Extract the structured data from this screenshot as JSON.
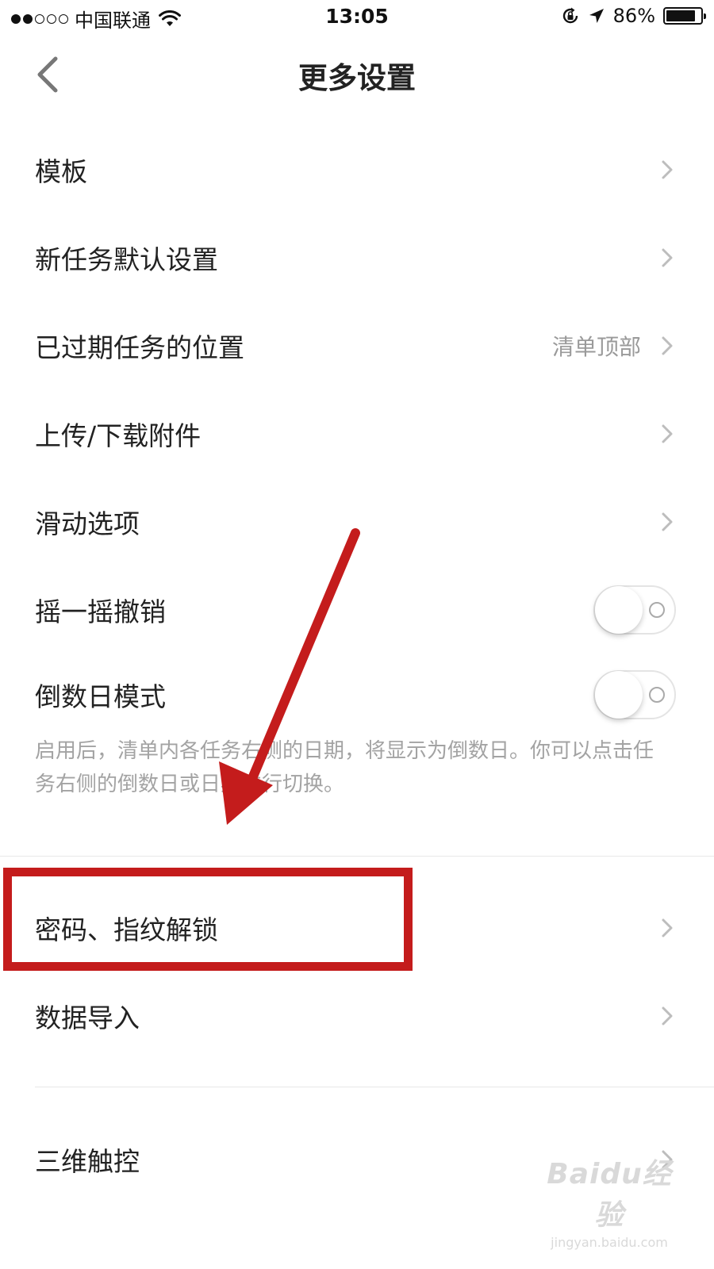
{
  "status_bar": {
    "carrier": "中国联通",
    "time": "13:05",
    "battery_percent": "86%",
    "battery_level": 0.86,
    "signal_dots_filled": 2,
    "signal_dots_total": 5
  },
  "nav": {
    "title": "更多设置",
    "back_icon": "chevron-left-icon"
  },
  "settings": {
    "template": {
      "label": "模板"
    },
    "new_task_defaults": {
      "label": "新任务默认设置"
    },
    "overdue_position": {
      "label": "已过期任务的位置",
      "value": "清单顶部"
    },
    "attachments": {
      "label": "上传/下载附件"
    },
    "swipe_options": {
      "label": "滑动选项"
    },
    "shake_undo": {
      "label": "摇一摇撤销",
      "enabled": false
    },
    "countdown_mode": {
      "label": "倒数日模式",
      "enabled": false
    },
    "countdown_description": "启用后，清单内各任务右侧的日期，将显示为倒数日。你可以点击任务右侧的倒数日或日期进行切换。",
    "password_unlock": {
      "label": "密码、指纹解锁"
    },
    "data_import": {
      "label": "数据导入"
    },
    "three_d_touch": {
      "label": "三维触控"
    }
  },
  "watermark": {
    "logo": "Baidu经验",
    "url": "jingyan.baidu.com"
  },
  "colors": {
    "annotation_red": "#c41c1c",
    "text_primary": "#222222",
    "text_secondary": "#9a9a9a",
    "chevron": "#bdbdbd"
  }
}
